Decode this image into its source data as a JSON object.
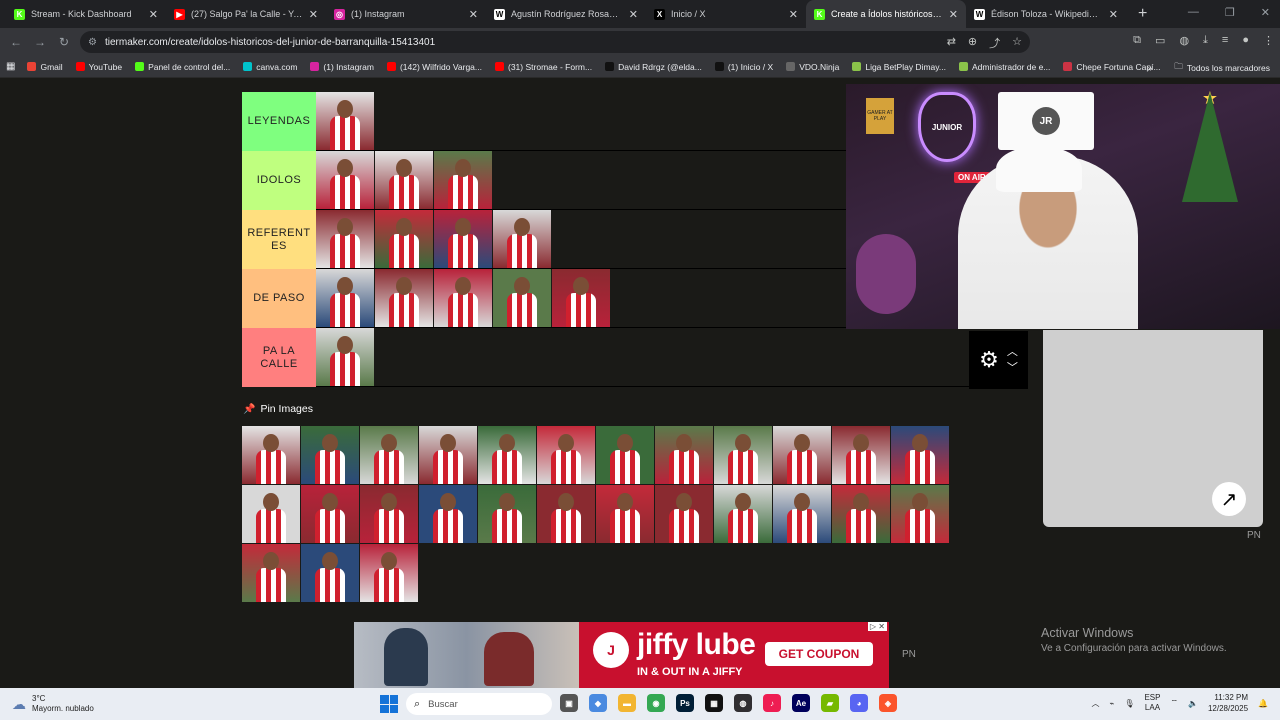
{
  "browser": {
    "tabs": [
      {
        "title": "Stream - Kick Dashboard",
        "favicon_color": "#53fc18",
        "glyph": "K",
        "active": false
      },
      {
        "title": "(27) Salgo Pa' la Calle - YouTube",
        "favicon_color": "#ff0000",
        "glyph": "▶",
        "active": false
      },
      {
        "title": "(1) Instagram",
        "favicon_color": "#d6249f",
        "glyph": "◎",
        "active": false
      },
      {
        "title": "Agustín Rodríguez Rosano - Wi",
        "favicon_color": "#ffffff",
        "glyph": "W",
        "active": false
      },
      {
        "title": "Inicio / X",
        "favicon_color": "#000000",
        "glyph": "X",
        "active": false
      },
      {
        "title": "Create a Ídolos históricos del Ju",
        "favicon_color": "#53fc18",
        "glyph": "K",
        "active": true
      },
      {
        "title": "Édison Toloza - Wikipedia, la e",
        "favicon_color": "#ffffff",
        "glyph": "W",
        "active": false
      }
    ],
    "new_tab_glyph": "+",
    "url": "tiermaker.com/create/idolos-historicos-del-junior-de-barranquilla-15413401",
    "bookmarks": [
      {
        "label": "Gmail",
        "color": "#ea4335"
      },
      {
        "label": "YouTube",
        "color": "#ff0000"
      },
      {
        "label": "Panel de control del...",
        "color": "#53fc18"
      },
      {
        "label": "canva.com",
        "color": "#00c4cc"
      },
      {
        "label": "(1) Instagram",
        "color": "#d6249f"
      },
      {
        "label": "(142) Wilfrido Varga...",
        "color": "#ff0000"
      },
      {
        "label": "(31) Stromae - Form...",
        "color": "#ff0000"
      },
      {
        "label": "David Rdrgz (@elda...",
        "color": "#111111"
      },
      {
        "label": "(1) Inicio / X",
        "color": "#111111"
      },
      {
        "label": "VDO.Ninja",
        "color": "#666666"
      },
      {
        "label": "Liga BetPlay Dimay...",
        "color": "#8bc34a"
      },
      {
        "label": "Administrador de e...",
        "color": "#8bc34a"
      },
      {
        "label": "Chepe Fortuna Capí...",
        "color": "#cc3344"
      }
    ],
    "bookmarks_overflow": "»",
    "all_bookmarks": "Todos los marcadores"
  },
  "tiers": [
    {
      "label": "LEYENDAS",
      "color": "#7fff7f",
      "count": 1
    },
    {
      "label": "IDOLOS",
      "color": "#bfff7f",
      "count": 3
    },
    {
      "label": "REFERENT ES",
      "color": "#ffdf7f",
      "count": 4
    },
    {
      "label": "DE PASO",
      "color": "#ffbf7f",
      "count": 5
    },
    {
      "label": "PA LA CALLE",
      "color": "#ff7f7f",
      "count": 1
    }
  ],
  "pin_images_label": "Pin Images",
  "pool_count": 27,
  "thumb_palette": [
    "#b8223a",
    "#d8d8d8",
    "#3a6b3a",
    "#8a2a30",
    "#e4e4e4",
    "#2b4a7a",
    "#c42a3a",
    "#5a7a4a"
  ],
  "webcam": {
    "neon_text": "JUNIOR",
    "on_air": "ON AIR",
    "box_text": "GAMER AT PLAY",
    "logo_text": "JR"
  },
  "expand_glyph": "↗",
  "pn_text": "PN",
  "ad": {
    "brand": "jiffy lube",
    "logo": "J",
    "tagline": "IN & OUT IN A JIFFY",
    "cta": "GET COUPON",
    "close": "▷ ✕"
  },
  "activate_windows": {
    "title": "Activar Windows",
    "subtitle": "Ve a Configuración para activar Windows."
  },
  "taskbar": {
    "weather_temp": "3°C",
    "weather_desc": "Mayorm. nublado",
    "search_placeholder": "Buscar",
    "lang_top": "ESP",
    "lang_bottom": "LAA",
    "time": "11:32 PM",
    "date": "12/28/2025",
    "apps": [
      {
        "name": "files-app",
        "color": "#555555",
        "glyph": "▣"
      },
      {
        "name": "copilot-app",
        "color": "#4a8ae0",
        "glyph": "◆"
      },
      {
        "name": "explorer-app",
        "color": "#f2b531",
        "glyph": "▬"
      },
      {
        "name": "chrome-app",
        "color": "#34a853",
        "glyph": "◉"
      },
      {
        "name": "photoshop-app",
        "color": "#001e36",
        "glyph": "Ps"
      },
      {
        "name": "capcut-app",
        "color": "#111111",
        "glyph": "▦"
      },
      {
        "name": "obs-app",
        "color": "#302e31",
        "glyph": "◍"
      },
      {
        "name": "tiktok-app",
        "color": "#ee1d52",
        "glyph": "♪"
      },
      {
        "name": "after-effects-app",
        "color": "#00005b",
        "glyph": "Ae"
      },
      {
        "name": "nvidia-app",
        "color": "#76b900",
        "glyph": "▰"
      },
      {
        "name": "discord-app",
        "color": "#5865f2",
        "glyph": "◕"
      },
      {
        "name": "brave-app",
        "color": "#fb542b",
        "glyph": "◈"
      }
    ]
  }
}
